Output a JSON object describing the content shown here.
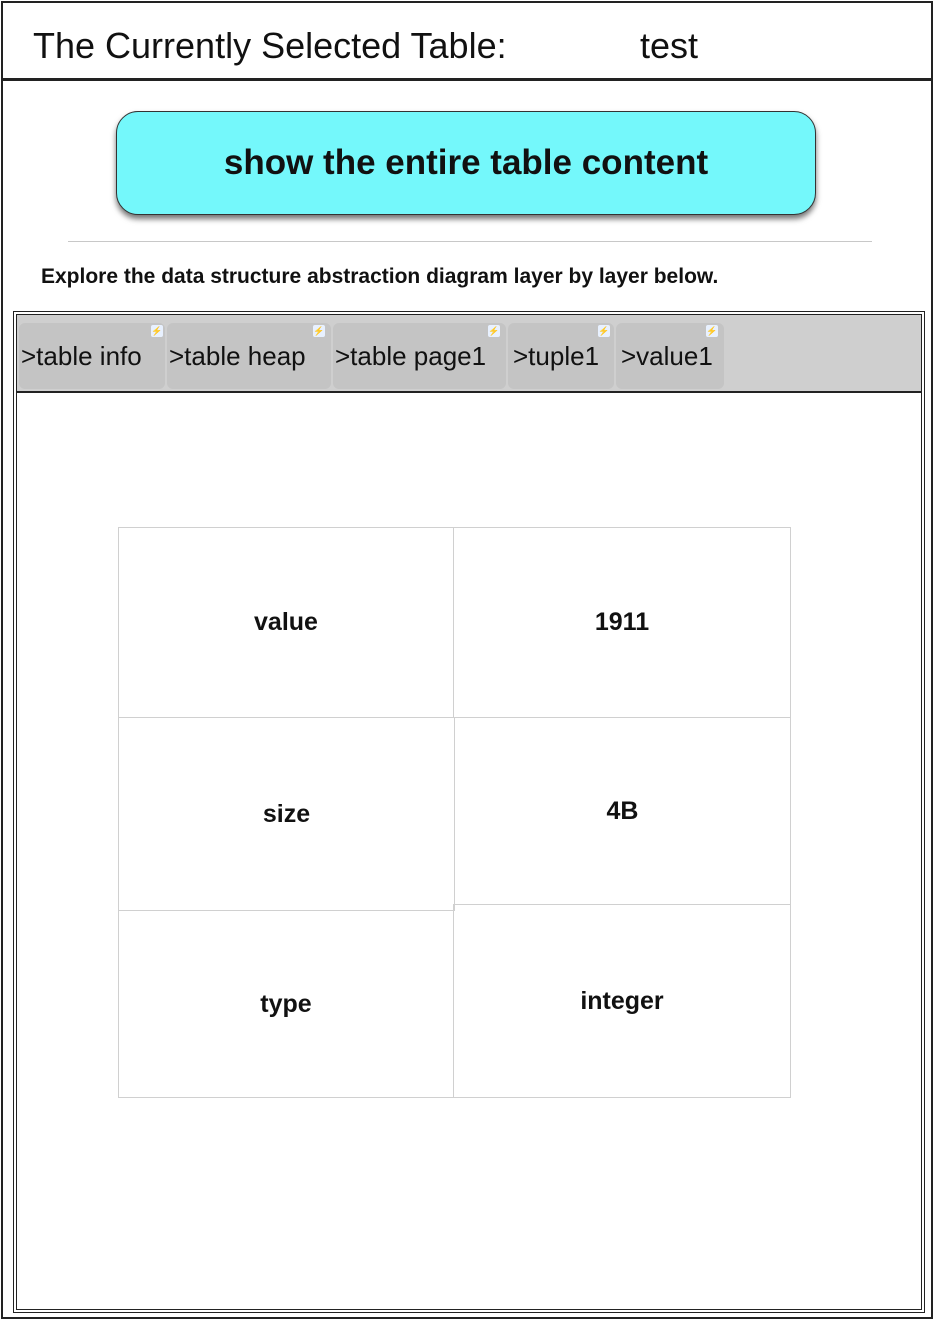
{
  "header": {
    "title": "The Currently Selected Table:",
    "table_name": "test"
  },
  "show_button_label": "show the entire table content",
  "explore_text": "Explore the data structure abstraction diagram layer by layer below.",
  "tabs": [
    {
      "label": ">table info"
    },
    {
      "label": ">table heap"
    },
    {
      "label": ">table page1"
    },
    {
      "label": ">tuple1"
    },
    {
      "label": ">value1"
    }
  ],
  "details": {
    "value_label": "value",
    "value": "1911",
    "size_label": "size",
    "size": "4B",
    "type_label": "type",
    "type": "integer"
  },
  "colors": {
    "button_bg": "#74f8fb",
    "tab_bar_bg": "#cfcfcf",
    "tab_bg": "#c4c4c4"
  }
}
